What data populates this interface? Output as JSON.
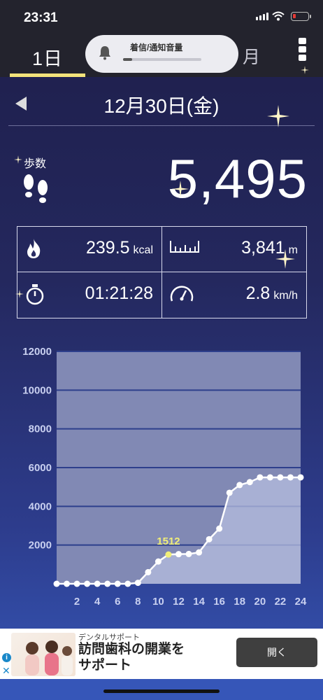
{
  "status_bar": {
    "time": "23:31"
  },
  "tabs": {
    "day": "1日",
    "month": "月"
  },
  "volume_popup": {
    "label": "着信/通知音量",
    "level": 0.12
  },
  "date": "12月30日(金)",
  "steps": {
    "label": "歩数",
    "value": "5,495"
  },
  "stats": {
    "calories": {
      "value": "239.5",
      "unit": "kcal"
    },
    "distance": {
      "value": "3,841",
      "unit": "m"
    },
    "duration": {
      "value": "01:21:28"
    },
    "speed": {
      "value": "2.8",
      "unit": "km/h"
    }
  },
  "chart_data": {
    "type": "area",
    "title": "",
    "xlabel": "",
    "ylabel": "",
    "xlim": [
      0,
      24
    ],
    "ylim": [
      0,
      12000
    ],
    "x_ticks": [
      "2",
      "4",
      "6",
      "8",
      "10",
      "12",
      "14",
      "16",
      "18",
      "20",
      "22",
      "24"
    ],
    "y_ticks": [
      "2000",
      "4000",
      "6000",
      "8000",
      "10000",
      "12000"
    ],
    "grid": true,
    "x": [
      0,
      1,
      2,
      3,
      4,
      5,
      6,
      7,
      8,
      9,
      10,
      11,
      12,
      13,
      14,
      15,
      16,
      17,
      18,
      19,
      20,
      21,
      22,
      23,
      24
    ],
    "values": [
      0,
      0,
      0,
      0,
      0,
      0,
      0,
      0,
      50,
      600,
      1150,
      1512,
      1530,
      1540,
      1620,
      2300,
      2850,
      4700,
      5100,
      5250,
      5495,
      5495,
      5495,
      5495,
      5495
    ],
    "highlight": {
      "x": 11,
      "label": "1512"
    }
  },
  "ad": {
    "sublabel": "デンタルサポート",
    "headline_line1": "訪問歯科の開業を",
    "headline_line2": "サポート",
    "button": "開く"
  },
  "colors": {
    "accent": "#f3e37b",
    "line": "#ffffff",
    "highlight": "#f1ee78",
    "grid": "#2d3f8c",
    "area": "#b6bedf"
  }
}
